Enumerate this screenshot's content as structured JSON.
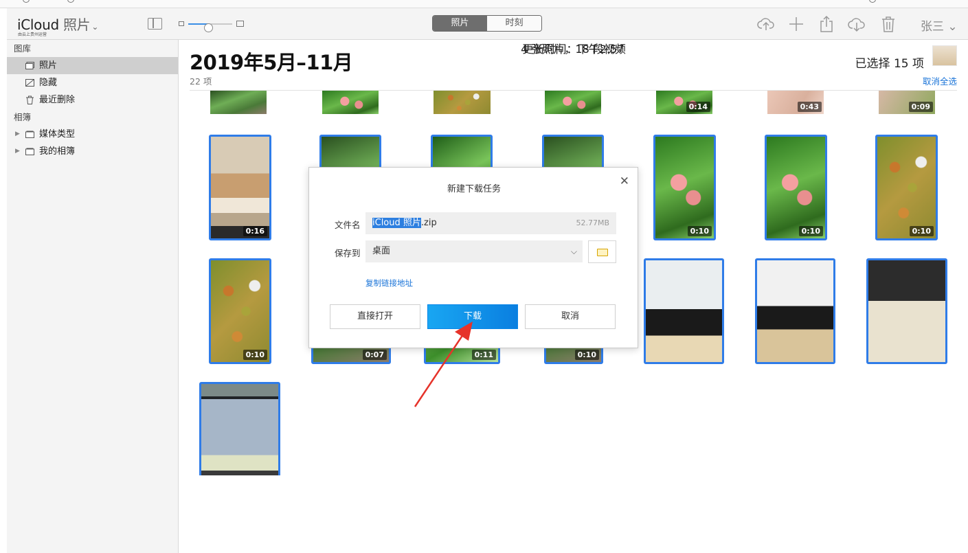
{
  "toolbar": {
    "app_name": "iCloud",
    "app_sub": "照片",
    "tagline": "由云上贵州运营",
    "segments": [
      "照片",
      "时刻"
    ],
    "active_segment": 0,
    "zoom_level": 0.45,
    "icons": [
      "upload-cloud-icon",
      "plus-icon",
      "share-icon",
      "download-cloud-icon",
      "trash-icon"
    ],
    "user": "张三"
  },
  "sidebar": {
    "library_header": "图库",
    "library_items": [
      {
        "label": "照片",
        "icon": "photos-icon",
        "active": true
      },
      {
        "label": "隐藏",
        "icon": "hidden-icon",
        "active": false
      },
      {
        "label": "最近删除",
        "icon": "trash-icon",
        "active": false
      }
    ],
    "albums_header": "相簿",
    "album_items": [
      {
        "label": "媒体类型",
        "icon": "folder-icon"
      },
      {
        "label": "我的相簿",
        "icon": "folder-icon"
      }
    ]
  },
  "main": {
    "title": "2019年5月–11月",
    "item_count": "22 项",
    "selected_text": "已选择 15 项",
    "deselect_all": "取消全选",
    "top_row_durations": [
      "",
      "",
      "",
      "",
      "0:14",
      "0:43",
      "0:09"
    ],
    "row2_durations": [
      "0:16",
      "",
      "",
      "",
      "0:10",
      "0:10",
      "0:10"
    ],
    "row3_durations": [
      "0:10",
      "0:07",
      "0:11",
      "0:10",
      "",
      "",
      ""
    ],
    "summary_line1": "4 张照片，18 段视频",
    "summary_line2": "更新时间：下午2:57"
  },
  "dialog": {
    "title": "新建下载任务",
    "filename_label": "文件名",
    "filename_highlight": "iCloud 照片",
    "filename_ext": ".zip",
    "filesize": "52.77MB",
    "saveto_label": "保存到",
    "saveto_value": "桌面",
    "copy_link": "复制链接地址",
    "btn_open": "直接打开",
    "btn_download": "下载",
    "btn_cancel": "取消"
  }
}
